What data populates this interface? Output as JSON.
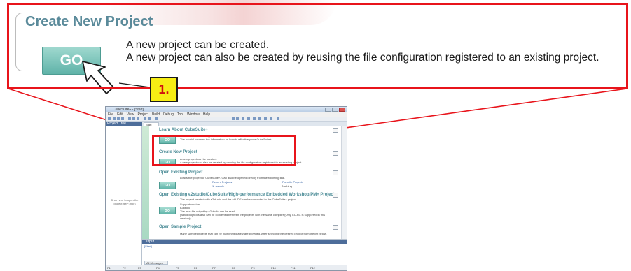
{
  "zoom": {
    "title": "Create New Project",
    "go_label": "GO",
    "line1": "A new project can be created.",
    "line2": "A new project can also be created by reusing the file configuration registered to an existing project.",
    "step_label": "1.",
    "colors": {
      "highlight": "#e8141b",
      "badge": "#f7ee14",
      "title": "#5a8a9a",
      "go": "#5fb3a8"
    }
  },
  "app": {
    "title": "CubeSuite+ - [Start]",
    "menu": [
      "File",
      "Edit",
      "View",
      "Project",
      "Build",
      "Debug",
      "Tool",
      "Window",
      "Help"
    ],
    "project_tree": "Project Tree",
    "drop_hint": "Drop here to open the project file(*.mtpj)",
    "start_tab": "Start",
    "sections": {
      "learn": {
        "title": "Learn About CubeSuite+",
        "line1": "We recommend reading the tutorial to find out what can be done in CubeSuite+.",
        "line2": "The tutorial contains the information on how to effectively use CubeSuite+."
      },
      "create": {
        "title": "Create New Project",
        "line1": "A new project can be created.",
        "line2": "A new project can also be created by reusing the file configuration registered to an existing project."
      },
      "open_existing": {
        "title": "Open Existing Project",
        "line1": "Loads the project of CubeSuite+. Can also be opened directly from the following link.",
        "recent_header": "Recent Projects",
        "favorite_header": "Favorite Projects",
        "recent_item": "1: sample",
        "favorite_item": "Nothing"
      },
      "open_other": {
        "title": "Open Existing e2studio/CubeSuite/High-performance Embedded Workshop/PM+ Project",
        "line1": "The project created with e2studio and the old IDE can be converted to the CubeSuite+ project.",
        "line2": "Support version:",
        "line3": "e2studio",
        "line4": "The mpc file output by e2studio can be read.",
        "line5": "(A Build options also can be converted between the projects with the same compiler (Only CC-RX is supported in this",
        "line6": "version))."
      },
      "sample": {
        "title": "Open Sample Project",
        "line1": "Many sample projects that can be built immediately are provided. After selecting the desired project from the list below,"
      }
    },
    "go_label": "GO",
    "output_title": "Output",
    "output_line": "[Start]",
    "all_messages": "All Messages",
    "fkeys": [
      "F1",
      "F2",
      "F3",
      "F4",
      "F5",
      "F6",
      "F7",
      "F8",
      "F9",
      "F10",
      "F11",
      "F12"
    ]
  }
}
